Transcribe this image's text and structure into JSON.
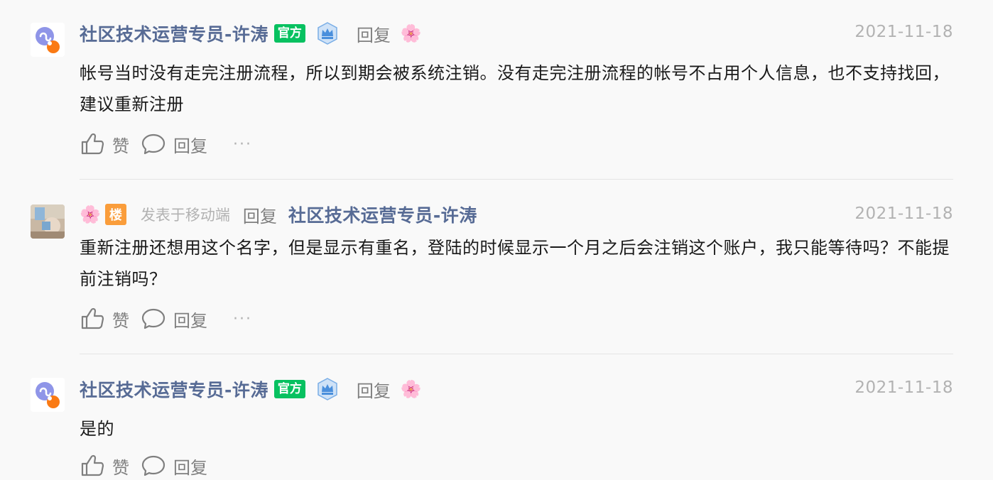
{
  "comments": [
    {
      "author": "社区技术运营专员-许涛",
      "official_badge": "官方",
      "reply_label": "回复",
      "date": "2021-11-18",
      "text": "帐号当时没有走完注册流程，所以到期会被系统注销。没有走完注册流程的帐号不占用个人信息，也不支持找回，建议重新注册",
      "actions": {
        "like": "赞",
        "reply": "回复"
      }
    },
    {
      "lou_badge": "楼",
      "source": "发表于移动端",
      "reply_label": "回复",
      "reply_to": "社区技术运营专员-许涛",
      "date": "2021-11-18",
      "text": "重新注册还想用这个名字，但是显示有重名，登陆的时候显示一个月之后会注销这个账户，我只能等待吗？不能提前注销吗？",
      "actions": {
        "like": "赞",
        "reply": "回复"
      }
    },
    {
      "author": "社区技术运营专员-许涛",
      "official_badge": "官方",
      "reply_label": "回复",
      "date": "2021-11-18",
      "text": "是的",
      "actions": {
        "like": "赞",
        "reply": "回复"
      }
    }
  ],
  "icons": {
    "flower": "🌸",
    "more": "···"
  },
  "colors": {
    "link": "#576b95",
    "official": "#07c160",
    "lou": "#fa9d3b",
    "muted": "#7f7f7f",
    "date": "#b2b2b2"
  }
}
